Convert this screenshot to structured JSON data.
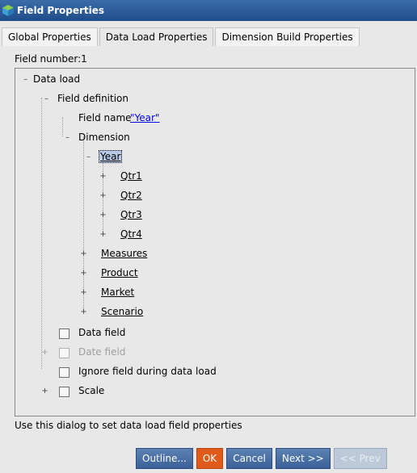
{
  "window": {
    "title": "Field Properties"
  },
  "tabs": [
    {
      "label": "Global Properties"
    },
    {
      "label": "Data Load Properties"
    },
    {
      "label": "Dimension Build Properties"
    }
  ],
  "field_number": "Field number:1",
  "tree": {
    "data_load": "Data load",
    "field_definition": "Field definition",
    "field_name_label": "Field name",
    "field_name_value": "\"Year\"",
    "dimension": "Dimension",
    "year": "Year",
    "year_children": [
      "Qtr1",
      "Qtr2",
      "Qtr3",
      "Qtr4"
    ],
    "other_dims": [
      "Measures",
      "Product",
      "Market",
      "Scenario"
    ],
    "data_field": "Data field",
    "date_field": "Date field",
    "ignore_field": "Ignore field during data load",
    "scale": "Scale"
  },
  "hint": "Use this dialog to set data load field properties",
  "buttons": {
    "outline": "Outline...",
    "ok": "OK",
    "cancel": "Cancel",
    "next": "Next >>",
    "prev": "<< Prev"
  }
}
